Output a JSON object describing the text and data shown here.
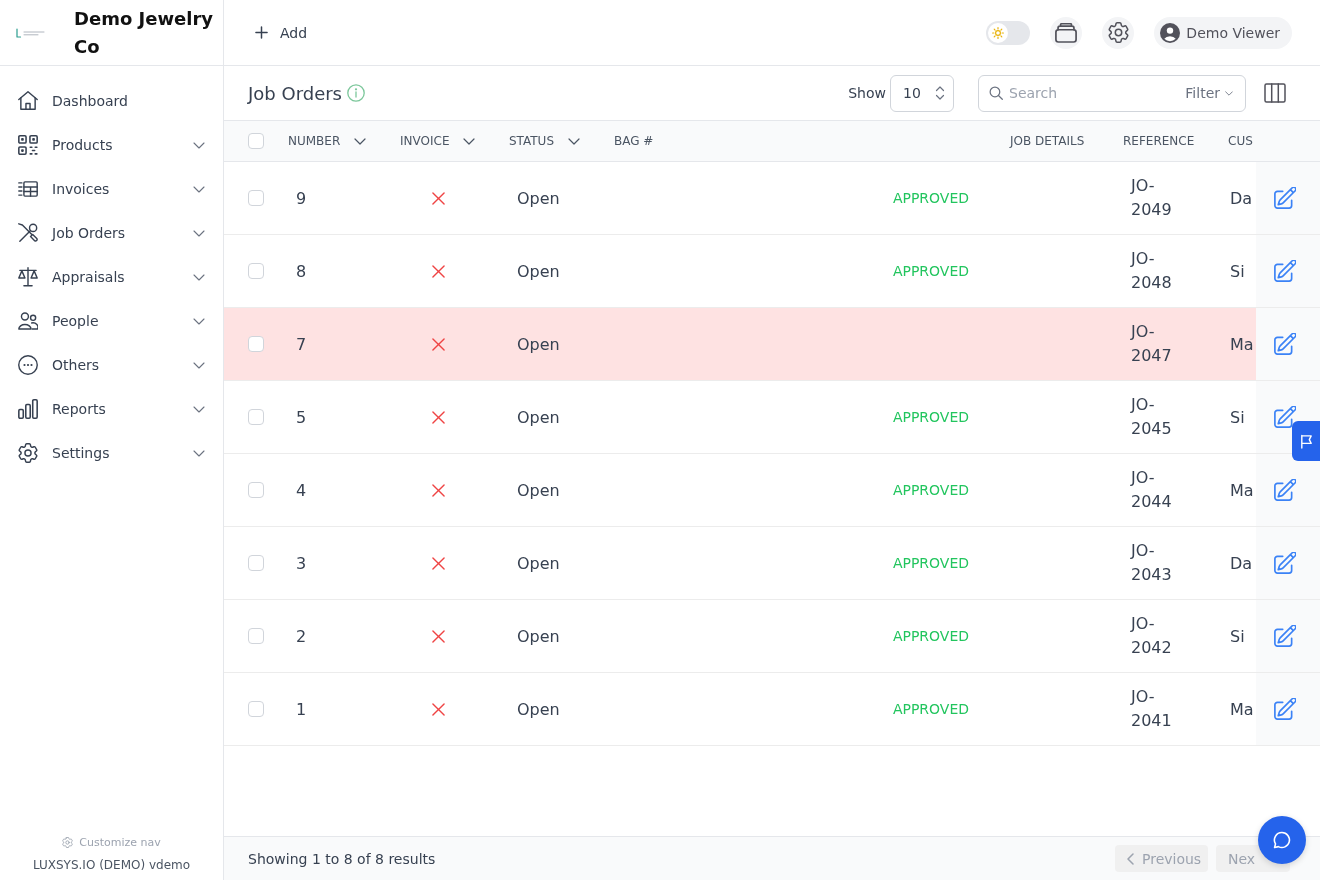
{
  "sidebar": {
    "company": "Demo Jewelry Co",
    "items": [
      {
        "label": "Dashboard"
      },
      {
        "label": "Products",
        "expanded": false
      },
      {
        "label": "Invoices",
        "expanded": false
      },
      {
        "label": "Job Orders",
        "expanded": false
      },
      {
        "label": "Appraisals",
        "expanded": false
      },
      {
        "label": "People",
        "expanded": false
      },
      {
        "label": "Others",
        "expanded": false
      },
      {
        "label": "Reports",
        "expanded": false
      },
      {
        "label": "Settings",
        "expanded": false
      }
    ],
    "customize_label": "Customize nav",
    "account": "LUXSYS.IO (DEMO) vdemo"
  },
  "header": {
    "add_label": "Add",
    "theme_toggle": {
      "on": false
    },
    "user": "Demo Viewer"
  },
  "toolbar": {
    "title": "Job Orders",
    "show_label": "Show",
    "page_size": "10",
    "search": {
      "placeholder": "Search"
    },
    "filter_label": "Filter"
  },
  "table": {
    "select_all": {
      "checked": false
    },
    "columns": [
      {
        "label": "NUMBER",
        "sortable": true
      },
      {
        "label": "INVOICE",
        "sortable": true
      },
      {
        "label": "STATUS",
        "sortable": true
      },
      {
        "label": "BAG #",
        "sortable": false
      },
      {
        "label": "JOB DETAILS",
        "sortable": false
      },
      {
        "label": "REFERENCE",
        "sortable": false
      },
      {
        "label": "CUS",
        "sortable": false
      }
    ],
    "rows": [
      {
        "number": "9",
        "invoiced": false,
        "status": "Open",
        "column_6": "APPROVED",
        "reference": "JO-2049",
        "column_9": "Da",
        "selected": false,
        "highlighted": false
      },
      {
        "number": "8",
        "invoiced": false,
        "status": "Open",
        "column_6": "APPROVED",
        "reference": "JO-2048",
        "column_9": "Si",
        "selected": false,
        "highlighted": false
      },
      {
        "number": "7",
        "invoiced": false,
        "status": "Open",
        "reference": "JO-2047",
        "column_9": "Ma",
        "selected": false,
        "highlighted": true
      },
      {
        "number": "5",
        "invoiced": false,
        "status": "Open",
        "column_6": "APPROVED",
        "reference": "JO-2045",
        "column_9": "Si",
        "selected": false,
        "highlighted": false
      },
      {
        "number": "4",
        "invoiced": false,
        "status": "Open",
        "column_6": "APPROVED",
        "reference": "JO-2044",
        "column_9": "Ma",
        "selected": false,
        "highlighted": false
      },
      {
        "number": "3",
        "invoiced": false,
        "status": "Open",
        "column_6": "APPROVED",
        "reference": "JO-2043",
        "column_9": "Da",
        "selected": false,
        "highlighted": false
      },
      {
        "number": "2",
        "invoiced": false,
        "status": "Open",
        "column_6": "APPROVED",
        "reference": "JO-2042",
        "column_9": "Si",
        "selected": false,
        "highlighted": false
      },
      {
        "number": "1",
        "invoiced": false,
        "status": "Open",
        "column_6": "APPROVED",
        "reference": "JO-2041",
        "column_9": "Ma",
        "selected": false,
        "highlighted": false
      }
    ]
  },
  "footer": {
    "summary": "Showing 1 to 8 of 8 results",
    "previous": {
      "label": "Previous",
      "disabled": true
    },
    "next": {
      "label": "Nex",
      "disabled": true
    }
  }
}
